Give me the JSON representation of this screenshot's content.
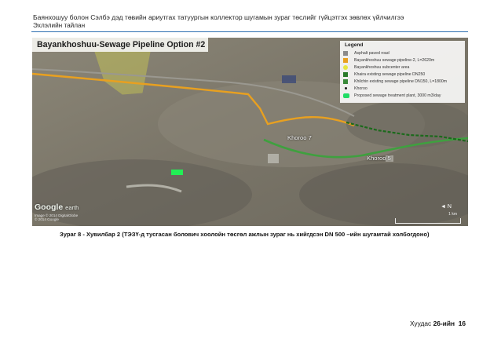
{
  "header": {
    "line1": "Баянхошуу болон Сэлбэ дэд төвийн ариутгах татуургын коллектор шугамын зураг төслийг гүйцэтгэх зөвлөх үйлчилгээ",
    "line2": "Эхлэлийн тайлан"
  },
  "map": {
    "title": "Bayankhoshuu-Sewage Pipeline Option #2",
    "legend": {
      "title": "Legend",
      "items": [
        {
          "label": "Asphalt paved road",
          "color": "#8a8a8a"
        },
        {
          "label": "Bayankhoshuu sewage pipeline-2, L=2620m",
          "color": "#e8a020"
        },
        {
          "label": "Bayankhoshuu subcenter area",
          "color": "#e6e640"
        },
        {
          "label": "Khaira existing sewage pipeline DN250",
          "color": "#2a7a2a"
        },
        {
          "label": "Khilchin existing sewage pipeline DN150, L=1800m",
          "color": "#3a8a3a"
        },
        {
          "label": "Khoroo",
          "color": "#222222"
        },
        {
          "label": "Proposed sewage treatment plant, 3000 m3/day",
          "color": "#22dd66"
        }
      ]
    },
    "labels": {
      "khoroo7": "Khoroo 7",
      "khoroo5": "Khoroo 5"
    },
    "watermark": {
      "google": "Google",
      "earth": "earth"
    },
    "copyright": [
      "Image © 2014 DigitalGlobe",
      "© 2014 Google"
    ],
    "scale": "1 km"
  },
  "caption": "Зураг  8 - Хувилбар 2 (ТЭЗҮ-д тусгасан болович хоолойн төсгөл ажлын зураг нь хийгдсэн DN 500 –ийн шугамтай холбогдоно)",
  "footer": {
    "prefix": "Хуудас ",
    "page_bold": "26-ийн",
    "page_num": "16"
  }
}
